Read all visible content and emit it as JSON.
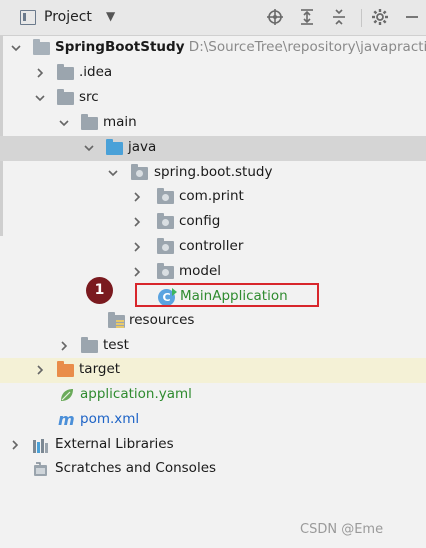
{
  "toolbar": {
    "title": "Project",
    "icons": [
      "locate-icon",
      "expand-all-icon",
      "collapse-all-icon",
      "gear-icon",
      "minimize-icon"
    ]
  },
  "tree": {
    "root": {
      "label": "SpringBootStudy",
      "path": "D:\\SourceTree\\repository\\javapractic"
    },
    "idea": ".idea",
    "src": "src",
    "main": "main",
    "java": "java",
    "package": "spring.boot.study",
    "com_print": "com.print",
    "config": "config",
    "controller": "controller",
    "model": "model",
    "main_application": "MainApplication",
    "resources": "resources",
    "test": "test",
    "target": "target",
    "application_yaml": "application.yaml",
    "pom_xml": "pom.xml",
    "external_libraries": "External Libraries",
    "scratches": "Scratches and Consoles"
  },
  "annotation": {
    "badge": "1"
  },
  "watermark": "CSDN @Eme",
  "colors": {
    "highlight_box": "#d8262c",
    "badge": "#7a1a1f",
    "selected_row": "#d5d5d5",
    "target_row": "#f4f1d6"
  }
}
